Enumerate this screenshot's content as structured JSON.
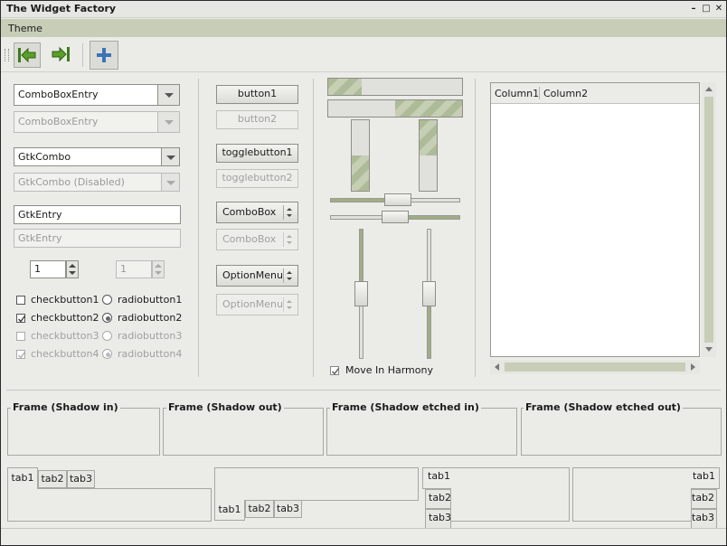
{
  "window": {
    "title": "The Widget Factory"
  },
  "menubar": {
    "items": [
      "Theme"
    ]
  },
  "combos": {
    "entry_value": "ComboBoxEntry",
    "entry_disabled_value": "ComboBoxEntry",
    "gtk_value": "GtkCombo",
    "gtk_disabled_value": "GtkCombo (Disabled)"
  },
  "entries": {
    "value": "GtkEntry",
    "disabled_value": "GtkEntry"
  },
  "spins": {
    "value": "1",
    "disabled_value": "1"
  },
  "checks": [
    "checkbutton1",
    "checkbutton2",
    "checkbutton3",
    "checkbutton4"
  ],
  "radios": [
    "radiobutton1",
    "radiobutton2",
    "radiobutton3",
    "radiobutton4"
  ],
  "buttons": {
    "button1": "button1",
    "button2": "button2",
    "toggle1": "togglebutton1",
    "toggle2": "togglebutton2",
    "combobox1": "ComboBox",
    "combobox2": "ComboBox",
    "option1": "OptionMenu",
    "option2": "OptionMenu"
  },
  "progress": {
    "h1": 0.25,
    "h2": 0.5,
    "v1": 0.5,
    "v2": 0.5
  },
  "move_in_harmony": "Move In Harmony",
  "tree": {
    "columns": [
      "Column1",
      "Column2"
    ]
  },
  "frames": [
    "Frame (Shadow in)",
    "Frame (Shadow out)",
    "Frame (Shadow etched in)",
    "Frame (Shadow etched out)"
  ],
  "tabs": [
    "tab1",
    "tab2",
    "tab3"
  ],
  "colors": {
    "accent": "#c7cdb6",
    "stripe_dark": "#aebb98",
    "stripe_light": "#c6cfb4",
    "icon_green": "#5aa028",
    "icon_blue": "#3b73b9"
  }
}
